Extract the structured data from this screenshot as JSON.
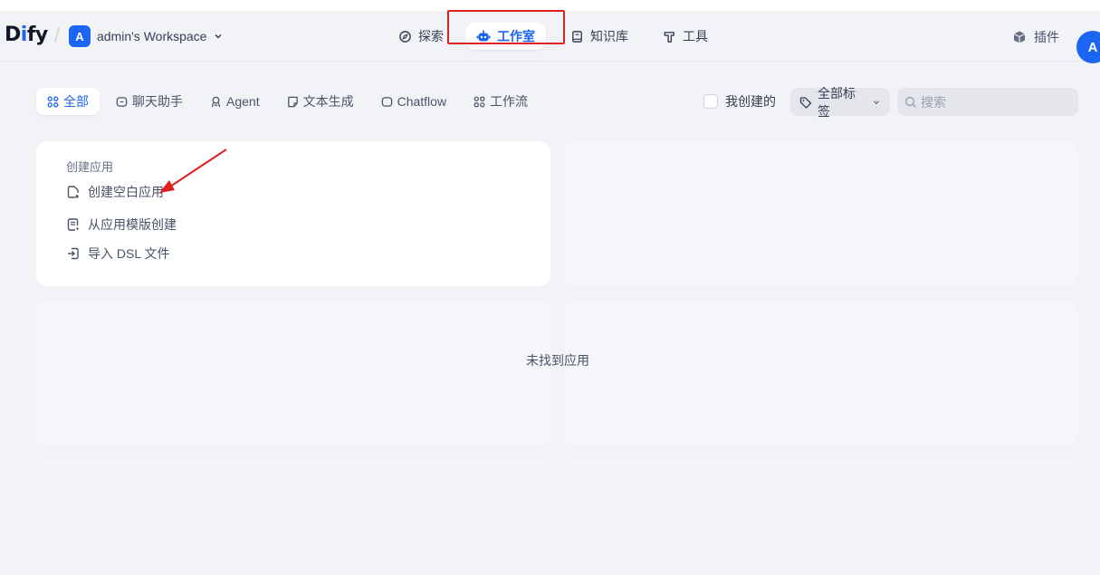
{
  "header": {
    "logo": {
      "prefix": "D",
      "accent": "i",
      "suffix": "fy"
    },
    "workspace": {
      "badge": "A",
      "name": "admin's Workspace"
    },
    "nav": [
      {
        "label": "探索",
        "icon": "compass-icon"
      },
      {
        "label": "工作室",
        "icon": "robot-icon",
        "active": true
      },
      {
        "label": "知识库",
        "icon": "book-icon"
      },
      {
        "label": "工具",
        "icon": "hammer-icon"
      }
    ],
    "plugins": {
      "label": "插件",
      "icon": "cube-icon"
    },
    "avatar": "A"
  },
  "filters": {
    "tabs": [
      {
        "label": "全部",
        "icon": "grid-icon",
        "active": true
      },
      {
        "label": "聊天助手",
        "icon": "chat-icon"
      },
      {
        "label": "Agent",
        "icon": "agent-icon"
      },
      {
        "label": "文本生成",
        "icon": "text-generation-icon"
      },
      {
        "label": "Chatflow",
        "icon": "chatflow-icon"
      },
      {
        "label": "工作流",
        "icon": "workflow-icon"
      }
    ],
    "created_by_me": {
      "label": "我创建的",
      "checked": false
    },
    "tags": {
      "label": "全部标签",
      "icon": "tag-icon"
    },
    "search": {
      "placeholder": "搜索",
      "value": ""
    }
  },
  "create_card": {
    "title": "创建应用",
    "items": [
      {
        "label": "创建空白应用",
        "icon": "new-file-icon"
      },
      {
        "label": "从应用模版创建",
        "icon": "template-icon"
      },
      {
        "label": "导入 DSL 文件",
        "icon": "import-icon"
      }
    ]
  },
  "empty_state": "未找到应用",
  "colors": {
    "accent": "#1c64f2",
    "annotation": "#e02020",
    "background": "#f2f3f7"
  }
}
